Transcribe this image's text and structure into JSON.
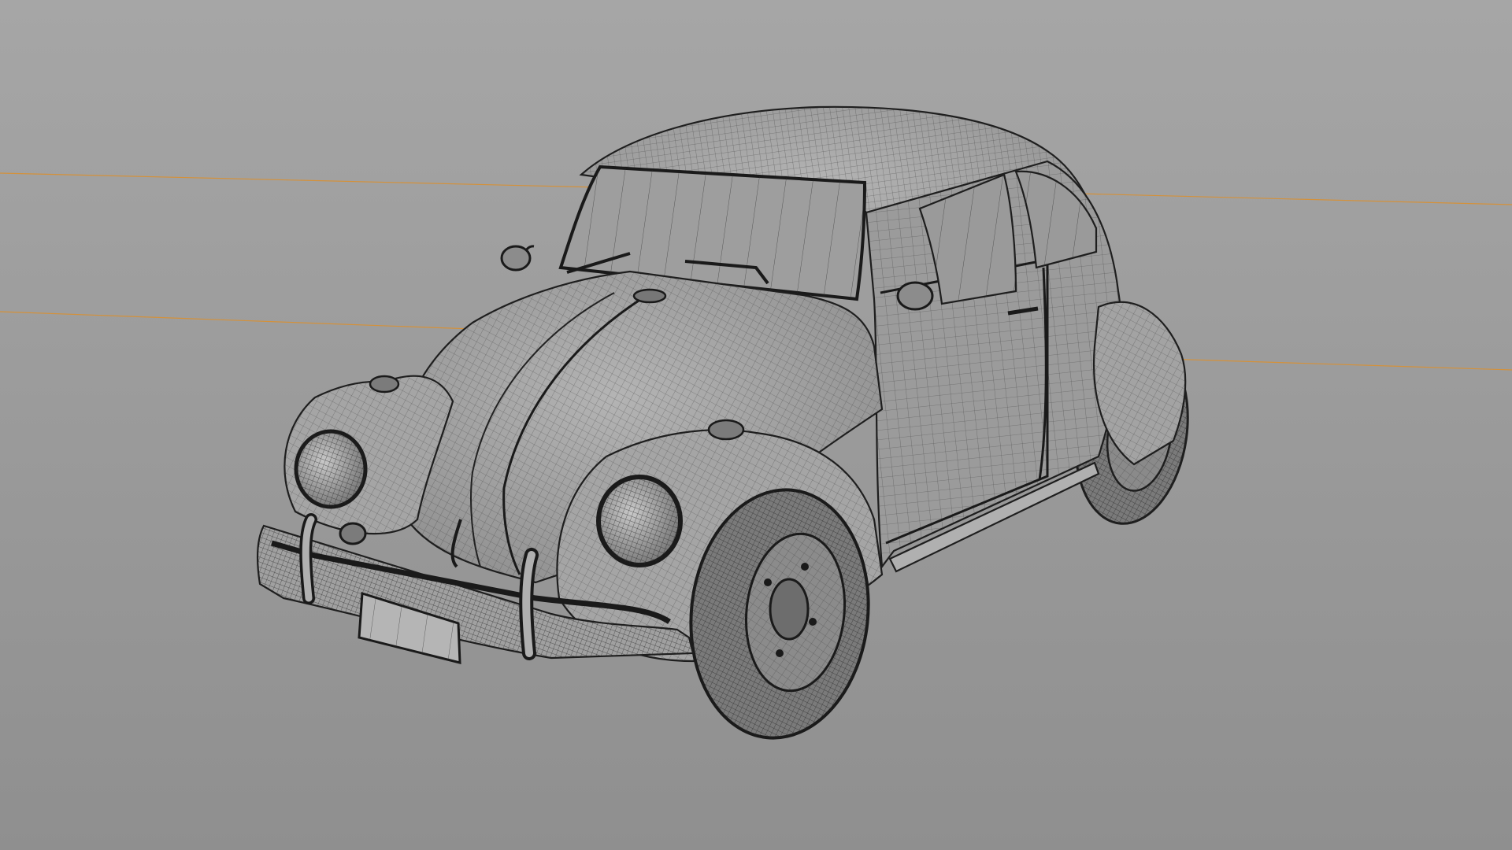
{
  "viewport": {
    "background_top": "#a6a6a6",
    "background_bottom": "#8f8f8f",
    "axis_line_color": "#d4913a",
    "wire_color": "#2a2a2a",
    "model_name": "car-wireframe",
    "view": "perspective",
    "shading": "wireframe-on-shaded"
  }
}
